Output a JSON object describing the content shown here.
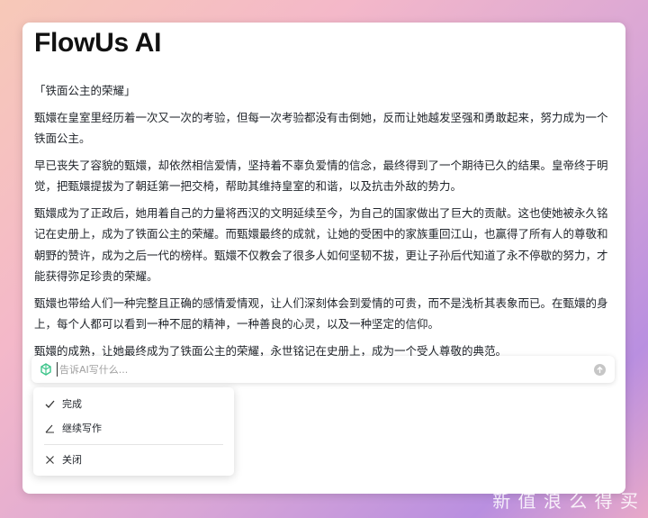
{
  "app": {
    "title": "FlowUs AI"
  },
  "document": {
    "paragraphs": [
      "「铁面公主的荣耀」",
      "甄嬛在皇室里经历着一次又一次的考验，但每一次考验都没有击倒她，反而让她越发坚强和勇敢起来，努力成为一个铁面公主。",
      "早已丧失了容貌的甄嬛，却依然相信爱情，坚持着不辜负爱情的信念，最终得到了一个期待已久的结果。皇帝终于明觉，把甄嬛提拔为了朝廷第一把交椅，帮助其维持皇室的和谐，以及抗击外敌的势力。",
      "甄嬛成为了正政后，她用着自己的力量将西汉的文明延续至今，为自己的国家做出了巨大的贡献。这也使她被永久铭记在史册上，成为了铁面公主的荣耀。而甄嬛最终的成就，让她的受困中的家族重回江山，也赢得了所有人的尊敬和朝野的赞许，成为之后一代的榜样。甄嬛不仅教会了很多人如何坚韧不拔，更让子孙后代知道了永不停歇的努力，才能获得弥足珍贵的荣耀。",
      "甄嬛也带给人们一种完整且正确的感情爱情观，让人们深刻体会到爱情的可贵，而不是浅析其表象而已。在甄嬛的身上，每个人都可以看到一种不屈的精神，一种善良的心灵，以及一种坚定的信仰。",
      "甄嬛的成熟，让她最终成为了铁面公主的荣耀，永世铭记在史册上，成为一个受人尊敬的典范。"
    ]
  },
  "ai_prompt": {
    "placeholder": "告诉AI写什么...",
    "logo_icon": "flowus-ai-logo-icon",
    "send_icon": "arrow-up-icon"
  },
  "menu": {
    "items": [
      {
        "label": "完成",
        "icon": "check-icon"
      },
      {
        "label": "继续写作",
        "icon": "pen-icon"
      },
      {
        "label": "关闭",
        "icon": "close-icon"
      }
    ]
  },
  "watermark": {
    "text": "新 值 浪 么 得 买"
  },
  "colors": {
    "accent_green": "#3cc48a",
    "text": "#1f2329",
    "placeholder": "#a0a0a0"
  }
}
